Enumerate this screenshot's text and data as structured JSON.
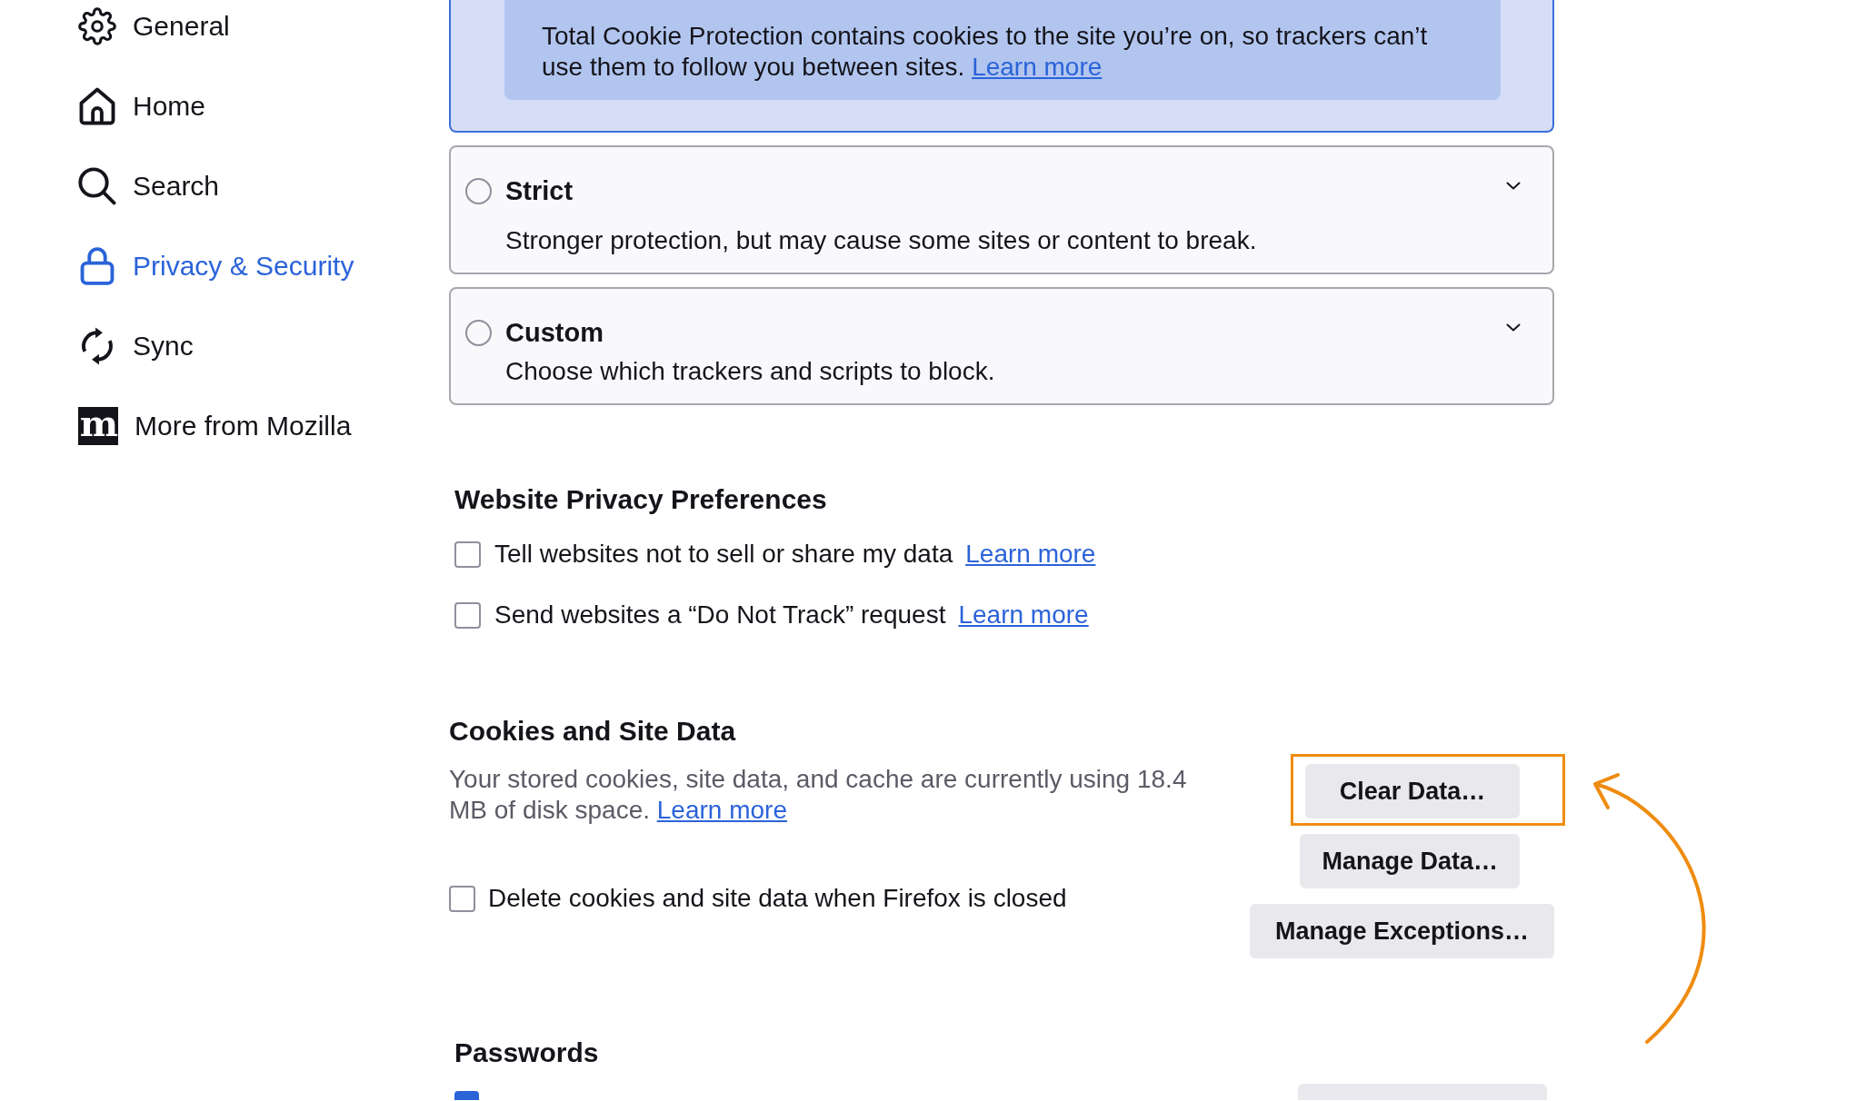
{
  "sidebar": {
    "items": [
      {
        "label": "General",
        "selected": false
      },
      {
        "label": "Home",
        "selected": false
      },
      {
        "label": "Search",
        "selected": false
      },
      {
        "label": "Privacy & Security",
        "selected": true
      },
      {
        "label": "Sync",
        "selected": false
      },
      {
        "label": "More from Mozilla",
        "selected": false,
        "logo_text": "m"
      }
    ]
  },
  "tracking_protection": {
    "options": [
      {
        "selected": true,
        "expanded": true,
        "details": "Total Cookie Protection contains cookies to the site you’re on, so trackers can’t use them to follow you between sites.",
        "link": "Learn more"
      },
      {
        "title": "Strict",
        "description": "Stronger protection, but may cause some sites or content to break.",
        "selected": false,
        "expanded": false
      },
      {
        "title": "Custom",
        "description": "Choose which trackers and scripts to block.",
        "selected": false,
        "expanded": false
      }
    ]
  },
  "website_privacy": {
    "heading": "Website Privacy Preferences",
    "options": [
      {
        "label": "Tell websites not to sell or share my data",
        "link": "Learn more",
        "checked": false
      },
      {
        "label": "Send websites a “Do Not Track” request",
        "link": "Learn more",
        "checked": false
      }
    ]
  },
  "cookies": {
    "heading": "Cookies and Site Data",
    "description": "Your stored cookies, site data, and cache are currently using 18.4 MB of disk space.",
    "link": "Learn more",
    "options": [
      {
        "label": "Delete cookies and site data when Firefox is closed",
        "checked": false
      }
    ],
    "buttons": [
      {
        "label": "Clear Data…",
        "highlighted": true
      },
      {
        "label": "Manage Data…",
        "highlighted": false
      },
      {
        "label": "Manage Exceptions…",
        "highlighted": false
      }
    ]
  },
  "passwords": {
    "heading": "Passwords",
    "checkbox": {
      "checked": true
    },
    "button": {
      "kind": "secondary"
    }
  }
}
